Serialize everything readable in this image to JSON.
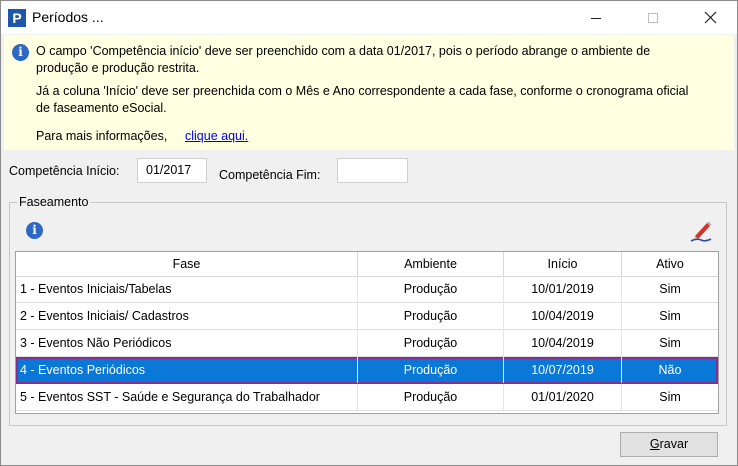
{
  "window": {
    "title": "Períodos ...",
    "app_icon": "P",
    "controls": [
      "minimize-icon",
      "maximize-icon",
      "close-icon"
    ]
  },
  "info": {
    "icon": "info-icon",
    "line1": "O campo 'Competência início' deve ser preenchido com a data 01/2017, pois o período abrange o ambiente de produção e produção restrita.",
    "line2": "Já a coluna 'Início' deve ser preenchida com o Mês e Ano correspondente a cada fase, conforme o cronograma oficial de faseamento eSocial.",
    "line3": "Para mais informações,",
    "link": "clique aqui."
  },
  "form": {
    "competencia_inicio_label": "Competência Início:",
    "competencia_inicio_value": "01/2017",
    "competencia_fim_label": "Competência Fim:",
    "competencia_fim_value": ""
  },
  "faseamento": {
    "legend": "Faseamento",
    "columns": [
      "Fase",
      "Ambiente",
      "Início",
      "Ativo"
    ],
    "rows": [
      {
        "fase": "1 - Eventos Iniciais/Tabelas",
        "ambiente": "Produção",
        "inicio": "10/01/2019",
        "ativo": "Sim"
      },
      {
        "fase": "2 - Eventos Iniciais/ Cadastros",
        "ambiente": "Produção",
        "inicio": "10/04/2019",
        "ativo": "Sim"
      },
      {
        "fase": "3 - Eventos Não Periódicos",
        "ambiente": "Produção",
        "inicio": "10/04/2019",
        "ativo": "Sim"
      },
      {
        "fase": "4 - Eventos Periódicos",
        "ambiente": "Produção",
        "inicio": "10/07/2019",
        "ativo": "Não"
      },
      {
        "fase": "5 - Eventos SST  - Saúde e Segurança do Trabalhador",
        "ambiente": "Produção",
        "inicio": "01/01/2020",
        "ativo": "Sim"
      }
    ],
    "selected_row": 3
  },
  "actions": {
    "gravar_label": "Gravar",
    "gravar_mnemonic": "G",
    "gravar_rest": "ravar"
  },
  "colors": {
    "selection": "#0a78d7",
    "selection_outline": "#8a2c8e",
    "info_background": "#ffffe1",
    "link": "#0000ee"
  }
}
